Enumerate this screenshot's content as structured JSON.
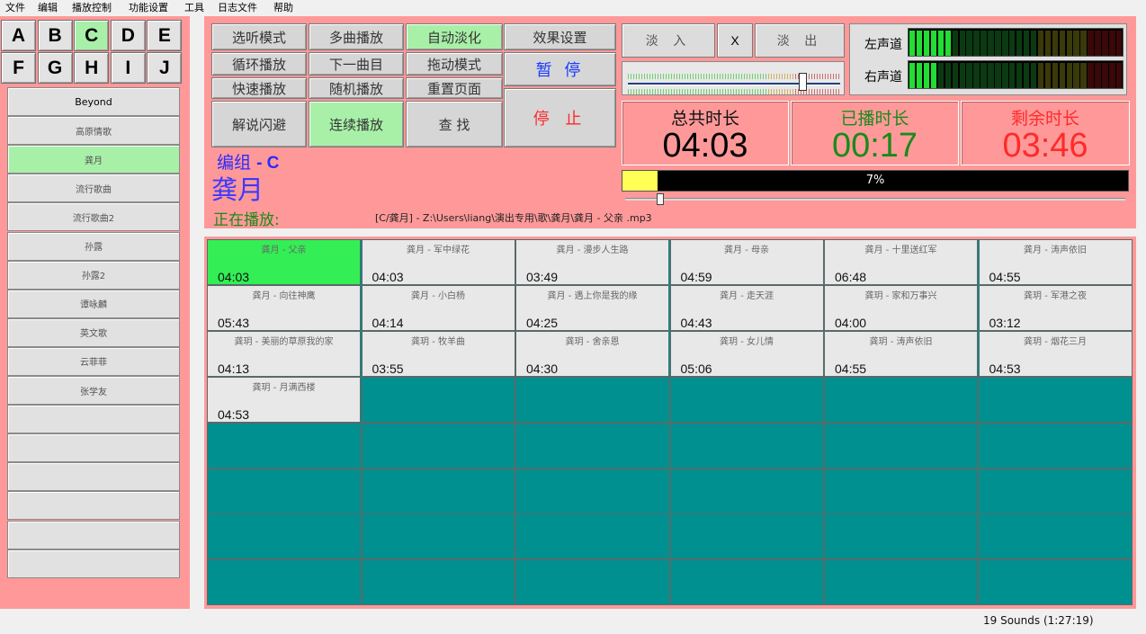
{
  "menu": [
    "文件",
    "编辑",
    "播放控制",
    "功能设置",
    "工具",
    "日志文件",
    "帮助"
  ],
  "letters": [
    "A",
    "B",
    "C",
    "D",
    "E",
    "F",
    "G",
    "H",
    "I",
    "J"
  ],
  "active_letter": "C",
  "groups": [
    "Beyond",
    "高原情歌",
    "龚月",
    "流行歌曲",
    "流行歌曲2",
    "孙露",
    "孙露2",
    "谭咏麟",
    "英文歌",
    "云菲菲",
    "张学友",
    "",
    "",
    "",
    "",
    "",
    ""
  ],
  "active_group": "龚月",
  "controls": {
    "preview_mode": "选听模式",
    "multi_play": "多曲播放",
    "auto_fade": "自动淡化",
    "effects": "效果设置",
    "loop_play": "循环播放",
    "next_track": "下一曲目",
    "drag_mode": "拖动模式",
    "pause": "暂 停",
    "fast_play": "快速播放",
    "random_play": "随机播放",
    "reset_page": "重置页面",
    "stop": "停 止",
    "narrate_dodge": "解说闪避",
    "continuous_play": "连续播放",
    "find": "查 找"
  },
  "fade": {
    "fade_in": "淡 入",
    "x": "X",
    "fade_out": "淡 出"
  },
  "volume": {
    "level": 0.82
  },
  "meters": {
    "left_label": "左声道",
    "right_label": "右声道",
    "left_level": 6,
    "right_level": 4,
    "segments": 30
  },
  "times": {
    "total_label": "总共时长",
    "total": "04:03",
    "played_label": "已播时长",
    "played": "00:17",
    "remaining_label": "剩余时长",
    "remaining": "03:46"
  },
  "progress": {
    "percent": 7,
    "text": "7%"
  },
  "group_line": {
    "label": "编组",
    "code": "- C"
  },
  "current_title": "龚月",
  "now_playing": {
    "label": "正在播放:",
    "path": "[C/龚月] - Z:\\Users\\liang\\演出专用\\歌\\龚月\\龚月 - 父亲 .mp3"
  },
  "songs": [
    {
      "title": "龚月 - 父亲",
      "duration": "04:03",
      "playing": true
    },
    {
      "title": "龚月 - 军中绿花",
      "duration": "04:03"
    },
    {
      "title": "龚月 - 漫步人生路",
      "duration": "03:49"
    },
    {
      "title": "龚月 - 母亲",
      "duration": "04:59"
    },
    {
      "title": "龚月 - 十里送红军",
      "duration": "06:48"
    },
    {
      "title": "龚月 - 涛声依旧",
      "duration": "04:55"
    },
    {
      "title": "龚月 - 向往神鹰",
      "duration": "05:43"
    },
    {
      "title": "龚月 - 小白杨",
      "duration": "04:14"
    },
    {
      "title": "龚月 - 遇上你是我的缘",
      "duration": "04:25"
    },
    {
      "title": "龚月 - 走天涯",
      "duration": "04:43"
    },
    {
      "title": "龚玥 - 家和万事兴",
      "duration": "04:00"
    },
    {
      "title": "龚玥 - 军港之夜",
      "duration": "03:12"
    },
    {
      "title": "龚玥 - 美丽的草原我的家",
      "duration": "04:13"
    },
    {
      "title": "龚玥 - 牧羊曲",
      "duration": "03:55"
    },
    {
      "title": "龚玥 - 舍亲恩",
      "duration": "04:30"
    },
    {
      "title": "龚玥 - 女儿情",
      "duration": "05:06"
    },
    {
      "title": "龚玥 - 涛声依旧",
      "duration": "04:55"
    },
    {
      "title": "龚玥 - 烟花三月",
      "duration": "04:53"
    },
    {
      "title": "龚玥 - 月满西楼",
      "duration": "04:53"
    }
  ],
  "status": "19 Sounds (1:27:19)"
}
